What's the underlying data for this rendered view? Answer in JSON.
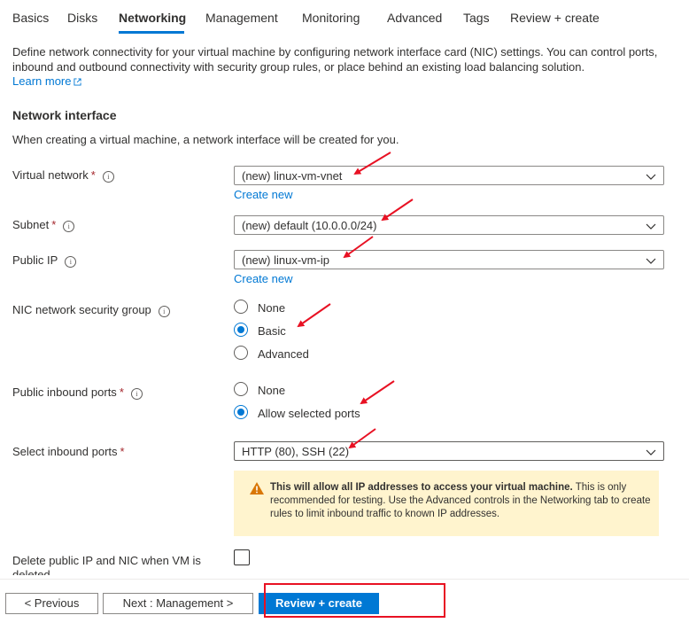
{
  "tabs": [
    {
      "label": "Basics",
      "active": false
    },
    {
      "label": "Disks",
      "active": false
    },
    {
      "label": "Networking",
      "active": true
    },
    {
      "label": "Management",
      "active": false
    },
    {
      "label": "Monitoring",
      "active": false
    },
    {
      "label": "Advanced",
      "active": false
    },
    {
      "label": "Tags",
      "active": false
    },
    {
      "label": "Review + create",
      "active": false
    }
  ],
  "intro": {
    "description": "Define network connectivity for your virtual machine by configuring network interface card (NIC) settings. You can control ports, inbound and outbound connectivity with security group rules, or place behind an existing load balancing solution.",
    "learn_more": "Learn more"
  },
  "network_interface": {
    "title": "Network interface",
    "description": "When creating a virtual machine, a network interface will be created for you."
  },
  "fields": {
    "virtual_network": {
      "label": "Virtual network",
      "value": "(new) linux-vm-vnet",
      "create_new": "Create new"
    },
    "subnet": {
      "label": "Subnet",
      "value": "(new) default (10.0.0.0/24)"
    },
    "public_ip": {
      "label": "Public IP",
      "value": "(new) linux-vm-ip",
      "create_new": "Create new"
    },
    "nic_nsg": {
      "label": "NIC network security group",
      "options": [
        "None",
        "Basic",
        "Advanced"
      ],
      "selected": "Basic"
    },
    "public_inbound_ports": {
      "label": "Public inbound ports",
      "options": [
        "None",
        "Allow selected ports"
      ],
      "selected": "Allow selected ports"
    },
    "select_inbound_ports": {
      "label": "Select inbound ports",
      "value": "HTTP (80), SSH (22)"
    },
    "delete_public_ip": {
      "label": "Delete public IP and NIC when VM is deleted",
      "checked": false
    }
  },
  "warning": {
    "bold": "This will allow all IP addresses to access your virtual machine.",
    "text": " This is only recommended for testing.  Use the Advanced controls in the Networking tab to create rules to limit inbound traffic to known IP addresses."
  },
  "footer": {
    "previous": "< Previous",
    "next": "Next : Management >",
    "review": "Review + create"
  },
  "colors": {
    "accent": "#0078d4",
    "required": "#a4262c",
    "warning_bg": "#fff4ce",
    "annotation": "#e81123"
  },
  "icons": {
    "info": "info-icon",
    "external": "external-link-icon",
    "chevron": "chevron-down-icon",
    "warning": "warning-triangle-icon"
  }
}
